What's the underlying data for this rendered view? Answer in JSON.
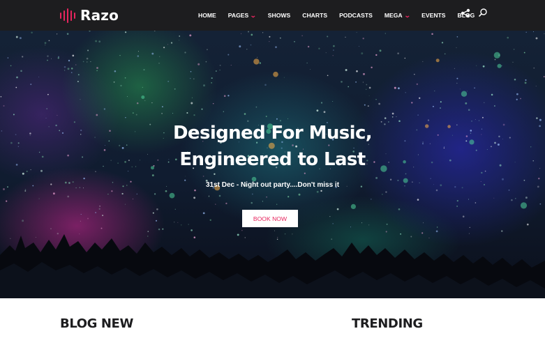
{
  "brand": {
    "name": "Razo",
    "accent_color": "#e7255e",
    "topbar_color": "#1d1d1f"
  },
  "nav": {
    "items": [
      {
        "label": "HOME",
        "dropdown": false
      },
      {
        "label": "PAGES",
        "dropdown": true
      },
      {
        "label": "SHOWS",
        "dropdown": false
      },
      {
        "label": "CHARTS",
        "dropdown": false
      },
      {
        "label": "PODCASTS",
        "dropdown": false
      },
      {
        "label": "MEGA",
        "dropdown": true
      },
      {
        "label": "EVENTS",
        "dropdown": false
      },
      {
        "label": "BLOG",
        "dropdown": false
      }
    ],
    "icons": [
      "share-icon",
      "search-icon"
    ]
  },
  "hero": {
    "title_line1": "Designed For Music,",
    "title_line2": "Engineered to Last",
    "subtitle": "31st Dec - Night out party....Don't miss it",
    "button_label": "BOOK NOW"
  },
  "sections": {
    "blog_title": "BLOG NEW",
    "trending_title": "TRENDING"
  }
}
